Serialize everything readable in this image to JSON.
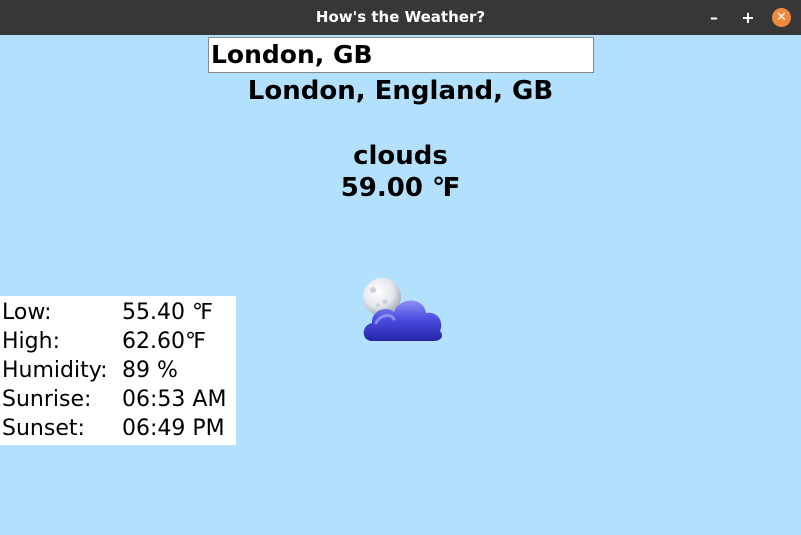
{
  "window": {
    "title": "How's the Weather?",
    "minimize_glyph": "–",
    "maximize_glyph": "+",
    "close_glyph": "✕",
    "background": "#b3e1fd",
    "titlebar_color": "#373737",
    "close_color": "#f08a3a"
  },
  "search": {
    "value": "London, GB"
  },
  "weather": {
    "location": "London, England, GB",
    "condition": "clouds",
    "temperature": "59.00 ℉",
    "icon": "cloud-with-moon-icon"
  },
  "details": [
    {
      "label": "Low:",
      "value": "55.40 ℉"
    },
    {
      "label": "High:",
      "value": "62.60℉"
    },
    {
      "label": "Humidity:",
      "value": "89 %"
    },
    {
      "label": "Sunrise:",
      "value": "06:53 AM"
    },
    {
      "label": "Sunset:",
      "value": "06:49 PM"
    }
  ]
}
